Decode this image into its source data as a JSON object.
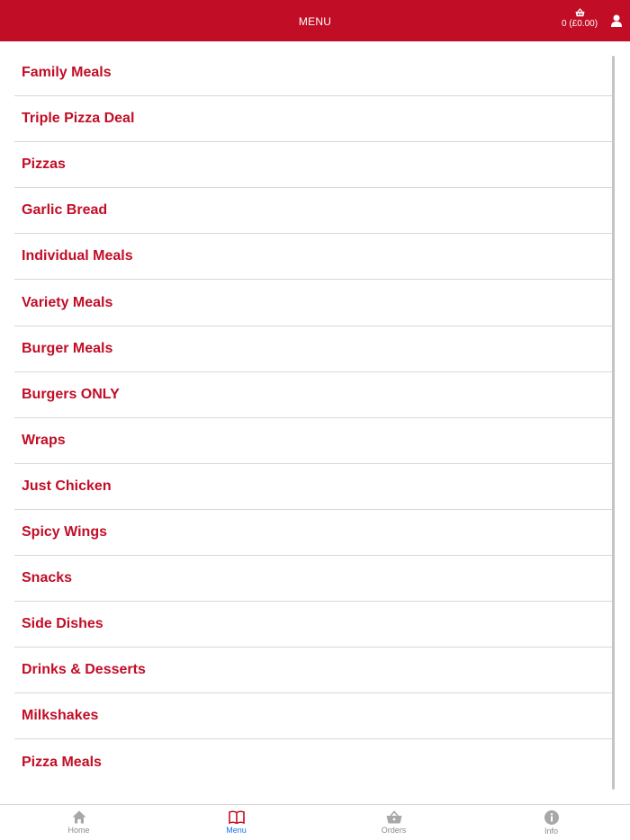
{
  "header": {
    "title": "MENU",
    "basket_count": "0 (£0.00)"
  },
  "menu": {
    "items": [
      "Family Meals",
      "Triple Pizza Deal",
      "Pizzas",
      "Garlic Bread",
      "Individual Meals",
      "Variety Meals",
      "Burger Meals",
      "Burgers ONLY",
      "Wraps",
      "Just Chicken",
      "Spicy Wings",
      "Snacks",
      "Side Dishes",
      "Drinks & Desserts",
      "Milkshakes",
      "Pizza Meals"
    ]
  },
  "tabbar": {
    "tabs": [
      {
        "label": "Home",
        "icon": "home-icon"
      },
      {
        "label": "Menu",
        "icon": "book-icon",
        "active": true
      },
      {
        "label": "Orders",
        "icon": "basket-icon"
      },
      {
        "label": "Info",
        "icon": "info-icon"
      }
    ]
  },
  "colors": {
    "brand_red": "#c20d26",
    "active_tab": "#1a73e8",
    "inactive_tab": "#8a8a8a"
  }
}
